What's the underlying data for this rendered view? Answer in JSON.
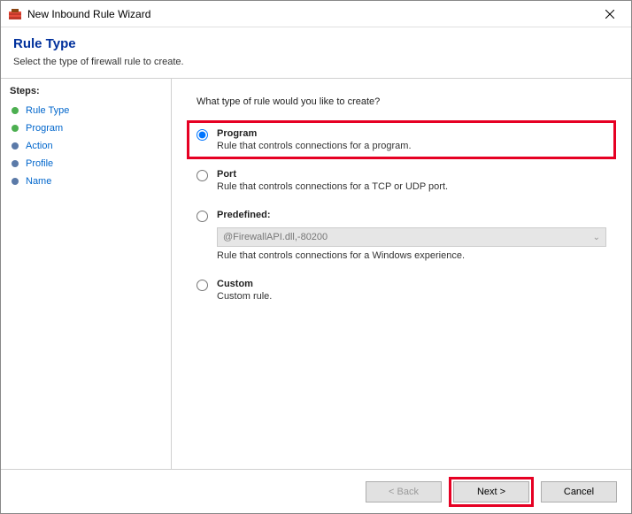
{
  "window": {
    "title": "New Inbound Rule Wizard"
  },
  "header": {
    "title": "Rule Type",
    "subtitle": "Select the type of firewall rule to create."
  },
  "sidebar": {
    "title": "Steps:",
    "items": [
      {
        "label": "Rule Type"
      },
      {
        "label": "Program"
      },
      {
        "label": "Action"
      },
      {
        "label": "Profile"
      },
      {
        "label": "Name"
      }
    ]
  },
  "main": {
    "question": "What type of rule would you like to create?",
    "options": {
      "program": {
        "title": "Program",
        "desc": "Rule that controls connections for a program."
      },
      "port": {
        "title": "Port",
        "desc": "Rule that controls connections for a TCP or UDP port."
      },
      "predefined": {
        "title": "Predefined:",
        "dropdown": "@FirewallAPI.dll,-80200",
        "desc": "Rule that controls connections for a Windows experience."
      },
      "custom": {
        "title": "Custom",
        "desc": "Custom rule."
      }
    }
  },
  "footer": {
    "back": "< Back",
    "next": "Next >",
    "cancel": "Cancel"
  }
}
